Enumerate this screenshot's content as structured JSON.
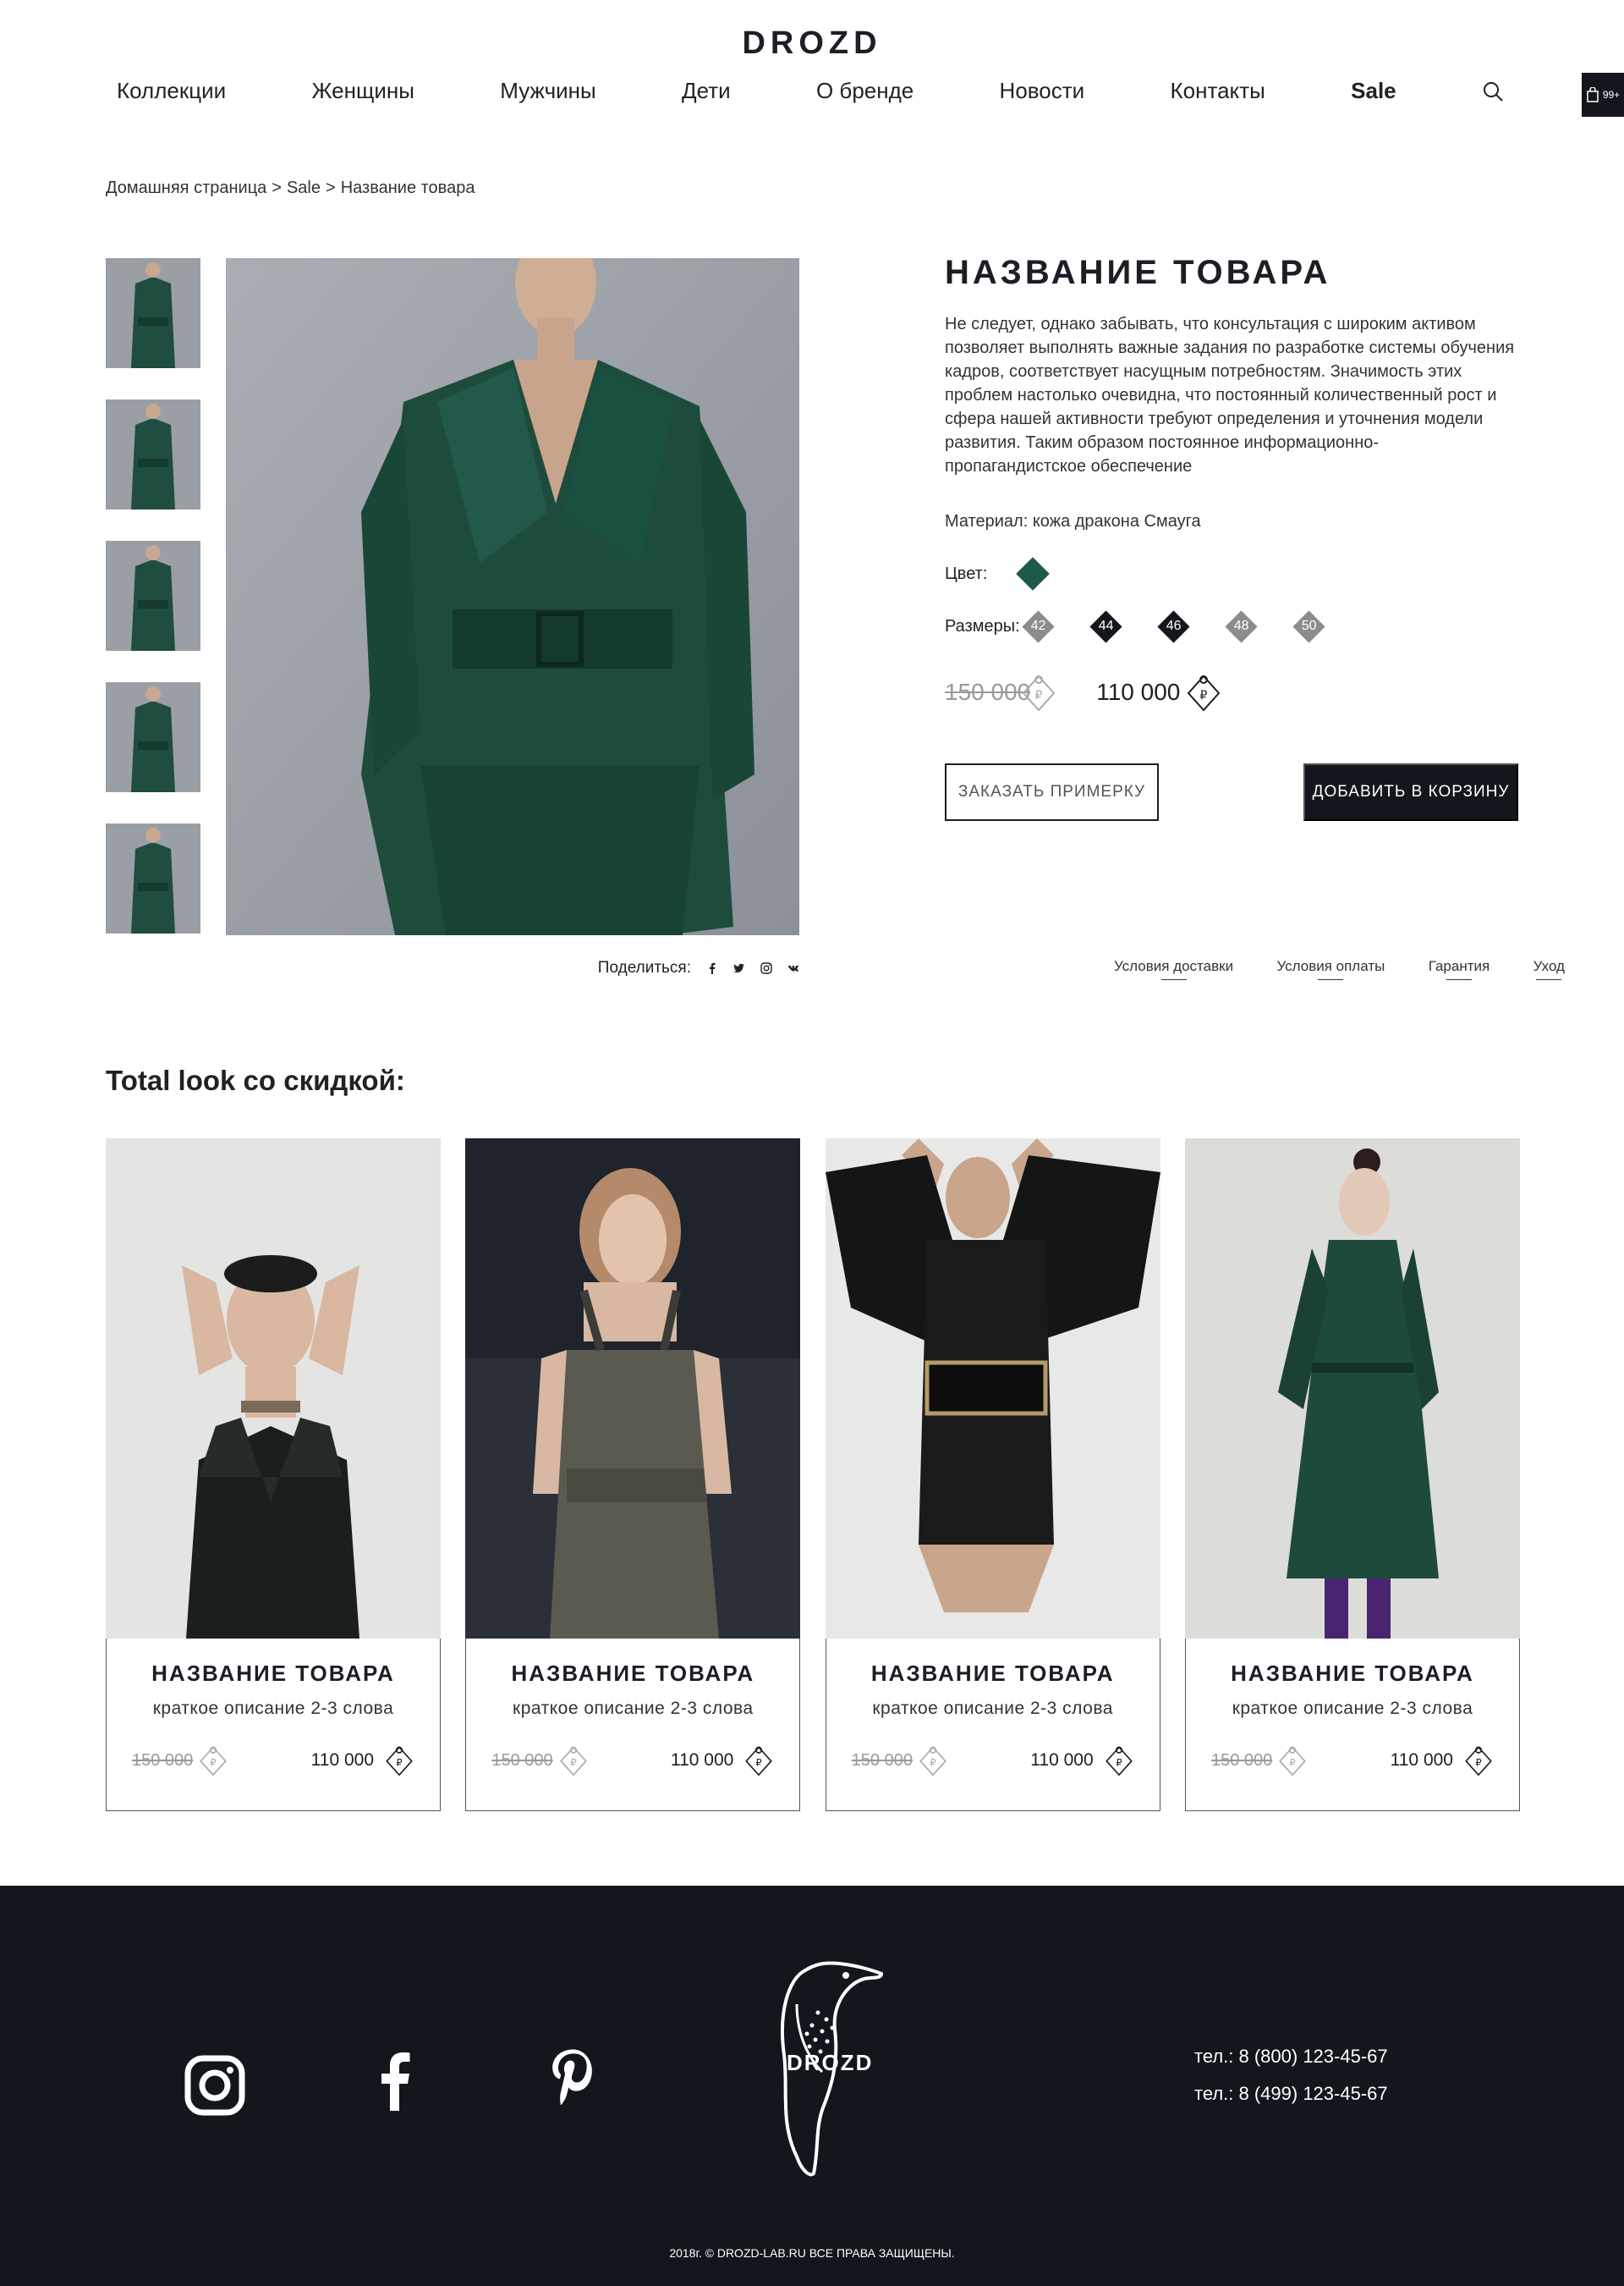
{
  "header": {
    "logo": "DROZD",
    "nav": [
      {
        "label": "Коллекции"
      },
      {
        "label": "Женщины"
      },
      {
        "label": "Мужчины"
      },
      {
        "label": "Дети"
      },
      {
        "label": "О бренде"
      },
      {
        "label": "Новости"
      },
      {
        "label": "Контакты"
      },
      {
        "label": "Sale"
      }
    ],
    "search_icon": "search-icon",
    "cart_count": "99+"
  },
  "breadcrumb": [
    "Домашняя страница",
    ">",
    "Sale",
    ">",
    "Название товара"
  ],
  "product": {
    "title": "НАЗВАНИЕ ТОВАРА",
    "description": "Не следует, однако забывать, что консультация с широким активом позволяет выполнять важные задания по разработке системы обучения кадров, соответствует насущным потребностям. Значимость этих проблем настолько очевидна, что постоянный количественный рост и сфера нашей активности требуют определения и уточнения модели развития. Таким образом постоянное информационно-пропагандистское обеспечение",
    "material": "Материал: кожа дракона Смауга",
    "color_label": "Цвет:",
    "color_value": "#1e5a49",
    "sizes_label": "Размеры:",
    "sizes": [
      {
        "value": "42",
        "color": "#8c8c8c"
      },
      {
        "value": "44",
        "color": "#13171d"
      },
      {
        "value": "46",
        "color": "#13171d"
      },
      {
        "value": "48",
        "color": "#8c8c8c"
      },
      {
        "value": "50",
        "color": "#8c8c8c"
      }
    ],
    "old_price": "150 000",
    "new_price": "110 000",
    "btn_fitting": "ЗАКАЗАТЬ ПРИМЕРКУ",
    "btn_cart": "ДОБАВИТЬ В КОРЗИНУ",
    "share_label": "Поделиться:",
    "share_icons": [
      "facebook-icon",
      "twitter-icon",
      "instagram-icon",
      "vk-icon"
    ],
    "info_links": [
      "Условия доставки",
      "Условия оплаты",
      "Гарантия",
      "Уход"
    ]
  },
  "total_look": {
    "title": "Total look со скидкой:",
    "cards": [
      {
        "title": "НАЗВАНИЕ ТОВАРА",
        "subtitle": "краткое описание 2-3 слова",
        "old_price": "150 000",
        "new_price": "110 000"
      },
      {
        "title": "НАЗВАНИЕ ТОВАРА",
        "subtitle": "краткое описание 2-3 слова",
        "old_price": "150 000",
        "new_price": "110 000"
      },
      {
        "title": "НАЗВАНИЕ ТОВАРА",
        "subtitle": "краткое описание 2-3 слова",
        "old_price": "150 000",
        "new_price": "110 000"
      },
      {
        "title": "НАЗВАНИЕ ТОВАРА",
        "subtitle": "краткое описание 2-3 слова",
        "old_price": "150 000",
        "new_price": "110 000"
      }
    ]
  },
  "footer": {
    "social": [
      "instagram-icon",
      "facebook-icon",
      "pinterest-icon"
    ],
    "logo": "DROZD",
    "phones": [
      "тел.: 8 (800) 123-45-67",
      "тел.: 8 (499) 123-45-67"
    ],
    "copyright": "2018г. © DROZD-LAB.RU ВСЕ ПРАВА ЗАЩИЩЕНЫ."
  },
  "colors": {
    "dark": "#13171d",
    "accent_green": "#1e5a49",
    "muted": "#8c8c8c"
  }
}
